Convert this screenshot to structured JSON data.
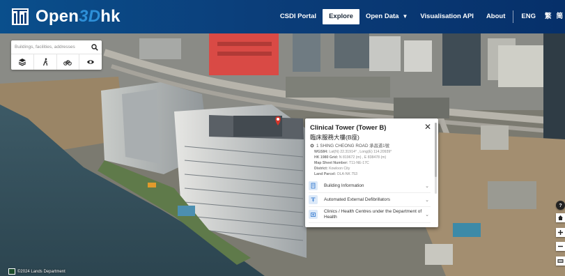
{
  "app": {
    "brand_name_prefix": "Open",
    "brand_name_mid": "3D",
    "brand_name_suffix": "hk"
  },
  "nav": {
    "items": [
      {
        "label": "CSDI Portal"
      },
      {
        "label": "Explore"
      },
      {
        "label": "Open Data"
      },
      {
        "label": "Visualisation API"
      },
      {
        "label": "About"
      }
    ],
    "lang_en": "ENG",
    "lang_tc": "繁",
    "lang_sc": "简"
  },
  "search": {
    "placeholder": "Buildings, facilities, addresses"
  },
  "tools": [
    {
      "icon": "layers-icon"
    },
    {
      "icon": "walking-icon"
    },
    {
      "icon": "bicycle-icon"
    },
    {
      "icon": "eye-icon"
    }
  ],
  "popup": {
    "title": "Clinical Tower (Tower B)",
    "subtitle": "臨床服務大樓(B座)",
    "address": "1 SHING CHEONG ROAD 承昌道1號",
    "wgs84_label": "WGS84:",
    "wgs84_value": "Lat(N) 22.31914° , Long(E) 114.20939°",
    "hk1980_label": "HK 1980 Grid:",
    "hk1980_value": "N 819672 (m) , E 838478 (m)",
    "map_sheet_label": "Map Sheet Number:",
    "map_sheet_value": "T11-NE-17C",
    "district_label": "District:",
    "district_value": "Kowloon City",
    "land_parcel_label": "Land Parcel:",
    "land_parcel_value": "OLA-NK 753",
    "sections": [
      {
        "label": "Building Information",
        "icon": "building-icon"
      },
      {
        "label": "Automated External Defibrillators",
        "icon": "aed-icon"
      },
      {
        "label": "Clinics / Health Centres under the Department of Health",
        "icon": "clinic-icon"
      }
    ]
  },
  "right_toolbar": [
    {
      "icon": "help-icon"
    },
    {
      "icon": "home-icon"
    },
    {
      "icon": "zoom-in-icon"
    },
    {
      "icon": "zoom-out-icon"
    },
    {
      "icon": "map-toggle-icon"
    }
  ],
  "attribution": "©2024 Lands Department",
  "colors": {
    "accent": "#0b3e7a",
    "brand_italic": "#2d8fd8",
    "section_icon": "#3b7fd1",
    "pin": "#d4362b"
  }
}
